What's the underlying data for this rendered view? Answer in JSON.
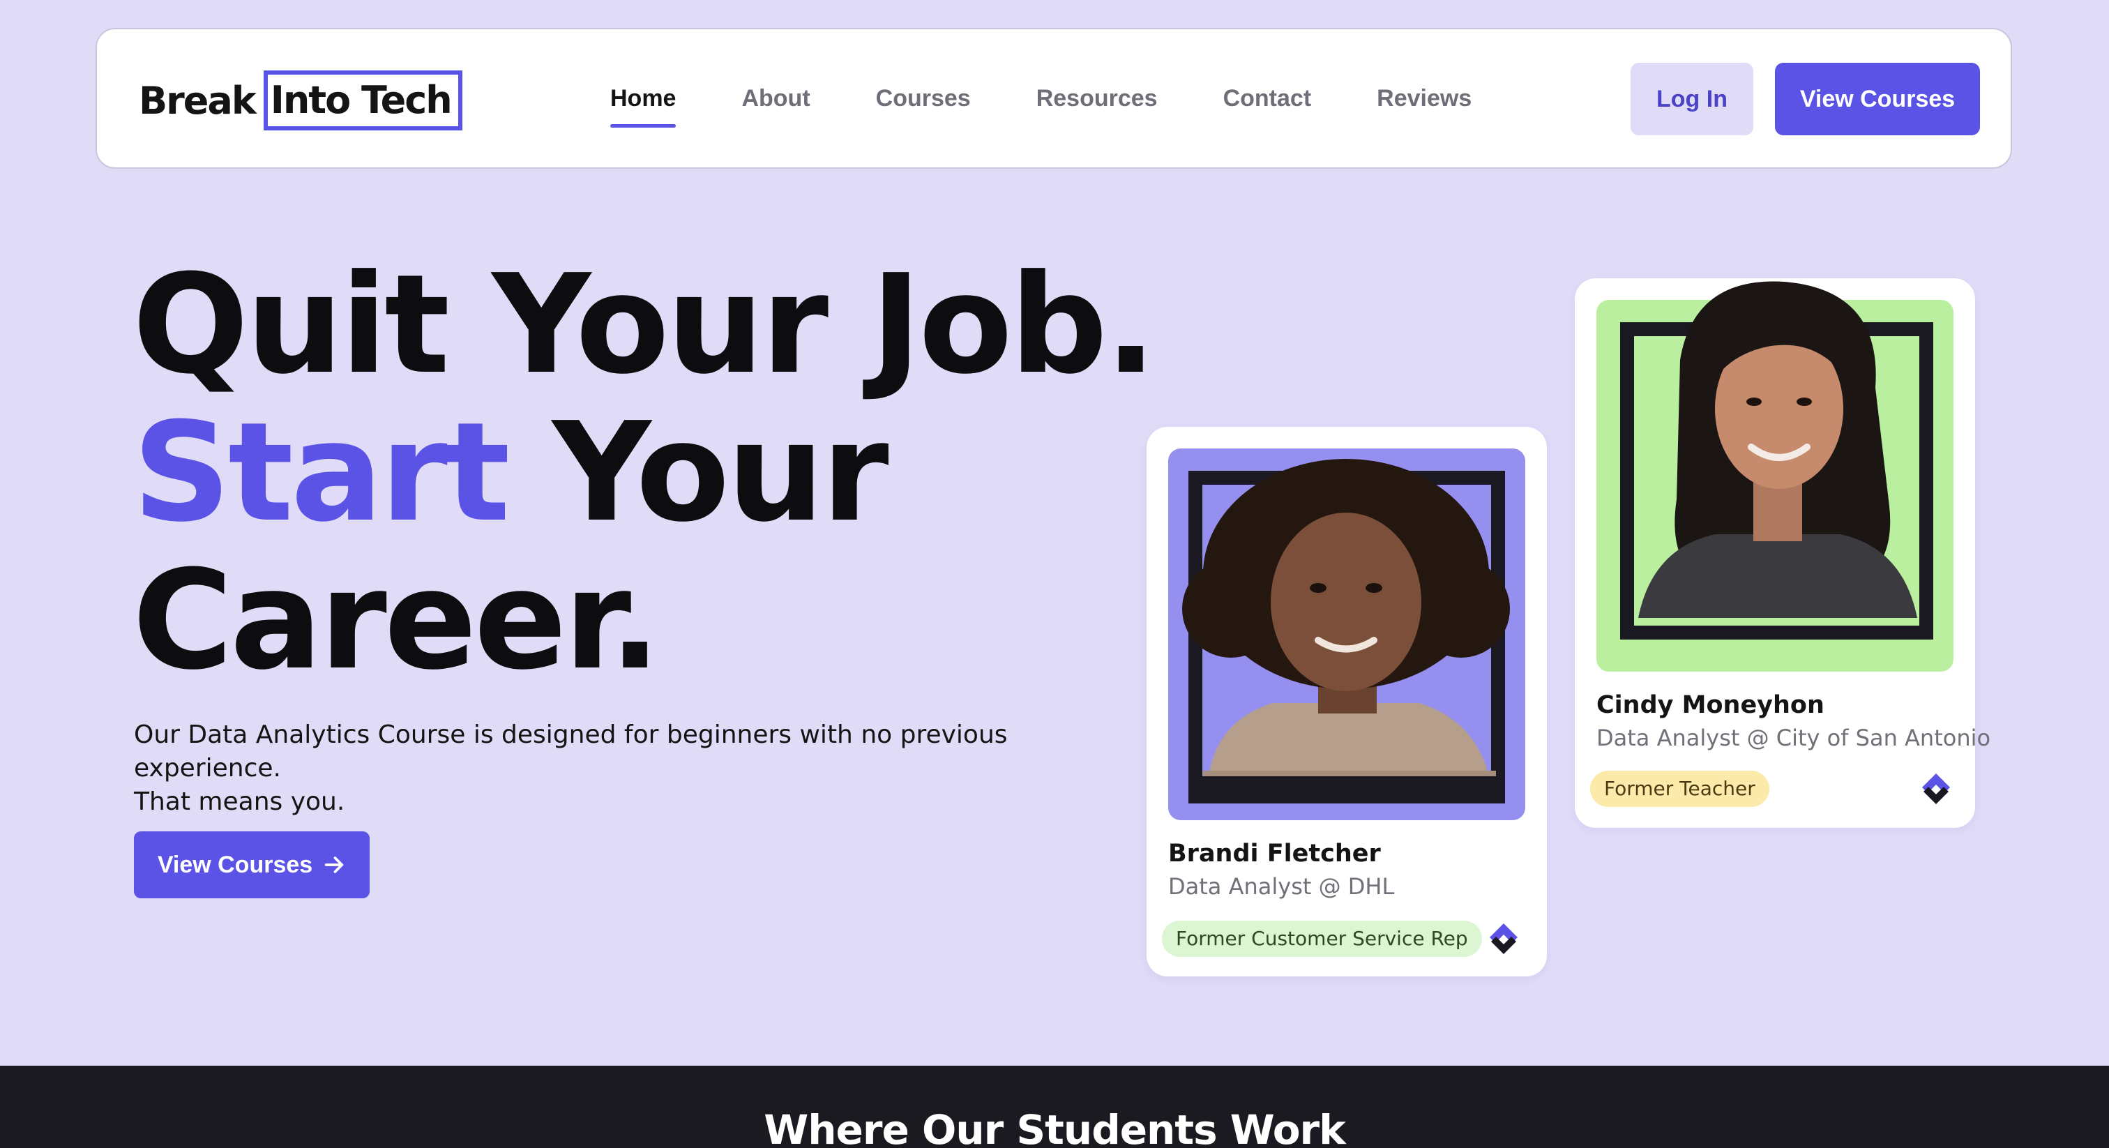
{
  "brand": {
    "logo_word_1": "Break",
    "logo_word_2": "Into Tech",
    "accent_color": "#5b53e6",
    "background_color": "#e0dcf8"
  },
  "nav": {
    "links": [
      {
        "label": "Home",
        "active": true
      },
      {
        "label": "About",
        "active": false
      },
      {
        "label": "Courses",
        "active": false
      },
      {
        "label": "Resources",
        "active": false
      },
      {
        "label": "Contact",
        "active": false
      },
      {
        "label": "Reviews",
        "active": false
      }
    ],
    "login_label": "Log In",
    "view_courses_label": "View Courses"
  },
  "hero": {
    "line1": "Quit Your Job.",
    "line2_accent": "Start",
    "line2_rest": " Your",
    "line3": "Career.",
    "subtext_line1": "Our Data Analytics Course is designed for beginners with no previous experience.",
    "subtext_line2": "That means you.",
    "cta_label": "View Courses",
    "cta_icon": "arrow-right-icon"
  },
  "testimonials": [
    {
      "name": "Brandi Fletcher",
      "role": "Data Analyst @  DHL",
      "tag": "Former Customer Service Rep",
      "photo_bg": "#9590f0",
      "tag_bg": "#dcf5d2",
      "tag_color": "#2c4a1e"
    },
    {
      "name": "Cindy Moneyhon",
      "role": "Data Analyst @ City of San Antonio",
      "tag": "Former Teacher",
      "photo_bg": "#b9ef9e",
      "tag_bg": "#fbeaa9",
      "tag_color": "#4a3a10"
    }
  ],
  "bottom_section": {
    "heading": "Where Our Students Work"
  }
}
